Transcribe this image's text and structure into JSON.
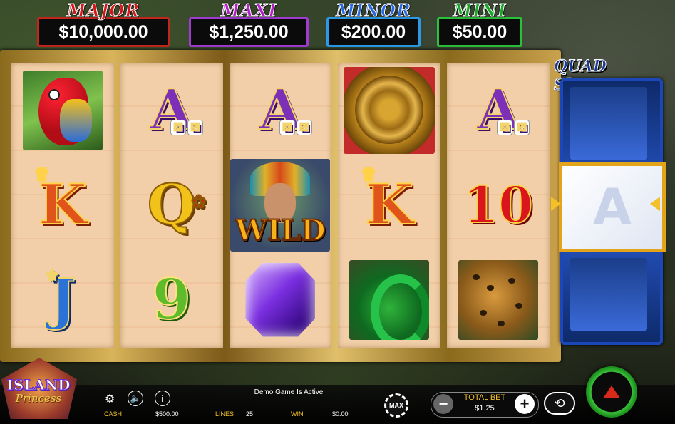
{
  "jackpots": [
    {
      "title": "MAJOR",
      "amount": "$10,000.00",
      "color": "#d8161c",
      "border": "#c3261e"
    },
    {
      "title": "MAXI",
      "amount": "$1,250.00",
      "color": "#b520c8",
      "border": "#a13ad0"
    },
    {
      "title": "MINOR",
      "amount": "$200.00",
      "color": "#2a6ae0",
      "border": "#2a9ae8"
    },
    {
      "title": "MINI",
      "amount": "$50.00",
      "color": "#1aa82a",
      "border": "#2ac23a"
    }
  ],
  "reels": [
    [
      "parrot",
      "K",
      "J"
    ],
    [
      "A",
      "Q",
      "9"
    ],
    [
      "A",
      "wild-princess",
      "purple-gem"
    ],
    [
      "aztec-calendar",
      "K",
      "green-snake"
    ],
    [
      "A",
      "10",
      "ocelot"
    ]
  ],
  "symbols": {
    "A": "A",
    "K": "K",
    "Q": "Q",
    "J": "J",
    "ten": "10",
    "nine": "9",
    "wild": "WILD"
  },
  "quad_shot": {
    "logo": "QUAD Shot",
    "center_symbol": "A"
  },
  "logo": {
    "line1": "ISLAND",
    "line2": "Princess"
  },
  "status": "Demo Game Is Active",
  "stats": {
    "cash_label": "CASH",
    "cash_value": "$500.00",
    "lines_label": "LINES",
    "lines_value": "25",
    "win_label": "WIN",
    "win_value": "$0.00"
  },
  "bet": {
    "label": "TOTAL BET",
    "value": "$1.25",
    "max_label": "MAX"
  },
  "icons": {
    "settings": "gear-icon",
    "sound": "speaker-icon",
    "info": "info-icon",
    "minus": "minus-icon",
    "plus": "plus-icon",
    "autoplay": "autoplay-icon",
    "spin": "spin-icon"
  }
}
